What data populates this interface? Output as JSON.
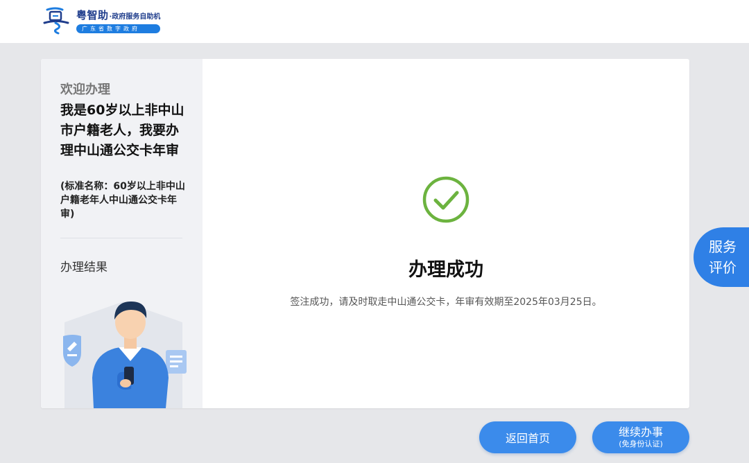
{
  "header": {
    "brand_name": "粤智助",
    "brand_sub": "·政府服务自助机",
    "brand_tag": "广东省数字政府"
  },
  "sidebar": {
    "welcome": "欢迎办理",
    "service_title": "我是60岁以上非中山市户籍老人，我要办理中山通公交卡年审",
    "standard_name": "(标准名称：60岁以上非中山户籍老年人中山通公交卡年审)",
    "result_label": "办理结果"
  },
  "result": {
    "title": "办理成功",
    "message": "签注成功，请及时取走中山通公交卡，年审有效期至2025年03月25日。"
  },
  "evaluation_tab": {
    "line1": "服务",
    "line2": "评价"
  },
  "buttons": {
    "home": "返回首页",
    "continue": "继续办事",
    "continue_sub": "(免身份认证)"
  },
  "colors": {
    "accent": "#3b8beb",
    "success": "#6cb33f",
    "brand": "#1f3d8c"
  }
}
